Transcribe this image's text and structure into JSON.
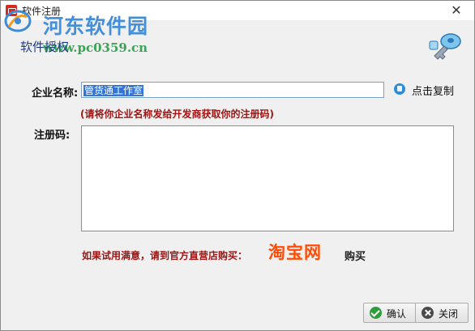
{
  "window": {
    "title": "软件注册",
    "close_glyph": "✕"
  },
  "watermark": {
    "name": "河东软件园",
    "url": "www.pc0359.cn"
  },
  "header": {
    "label": "软件授权",
    "icon": "key-icon"
  },
  "form": {
    "company_label": "企业名称:",
    "company_value": "管货通工作室",
    "copy_label": "点击复制",
    "hint": "(请将你企业名称发给开发商获取你的注册码)",
    "reg_label": "注册码:",
    "reg_value": ""
  },
  "purchase": {
    "text": "如果试用满意，请到官方直营店购买：",
    "taobao_mark": "淘宝网",
    "taobao_buy": "购买"
  },
  "buttons": {
    "ok_label": "确认",
    "close_label": "关闭"
  },
  "colors": {
    "accent": "#3375d6",
    "hint_red": "#a01414",
    "taobao_orange": "#ff4c06"
  }
}
